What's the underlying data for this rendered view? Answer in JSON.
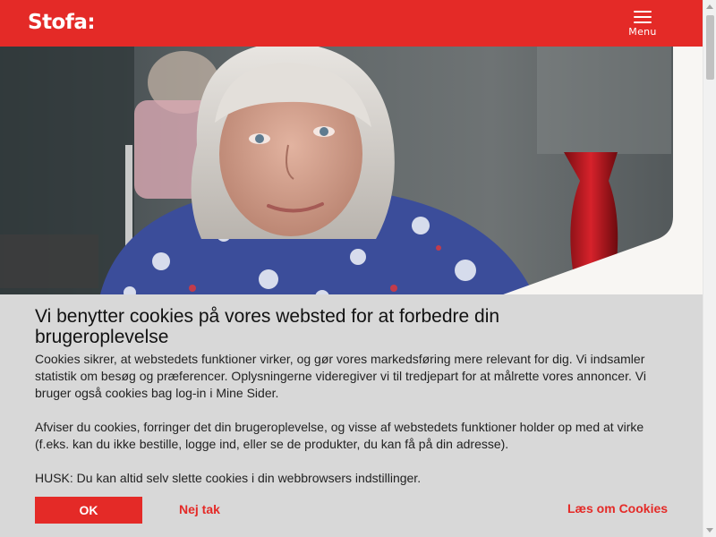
{
  "header": {
    "logo": "Stofa:",
    "menu_label": "Menu"
  },
  "hero": {
    "image_icon": "photo-elderly-woman"
  },
  "cookie_banner": {
    "title": "Vi benytter cookies på vores websted for at forbedre din brugeroplevelse",
    "paragraph1": "Cookies sikrer, at webstedets funktioner virker, og gør vores markedsføring mere relevant for dig. Vi indsamler statistik om besøg og præferencer. Oplysningerne videregiver vi til tredjepart for at målrette vores annoncer. Vi bruger også cookies bag log-in i Mine Sider.",
    "paragraph2": "Afviser du cookies, forringer det din brugeroplevelse, og visse af webstedets funktioner holder op med at virke (f.eks. kan du ikke bestille, logge ind, eller se de produkter, du kan få på din adresse).",
    "paragraph3": "HUSK: Du kan altid selv slette cookies i din webbrowsers indstillinger.",
    "ok_label": "OK",
    "deny_label": "Nej tak",
    "read_label": "Læs om Cookies"
  },
  "colors": {
    "brand_red": "#e42a27",
    "banner_bg": "#d8d8d8"
  }
}
